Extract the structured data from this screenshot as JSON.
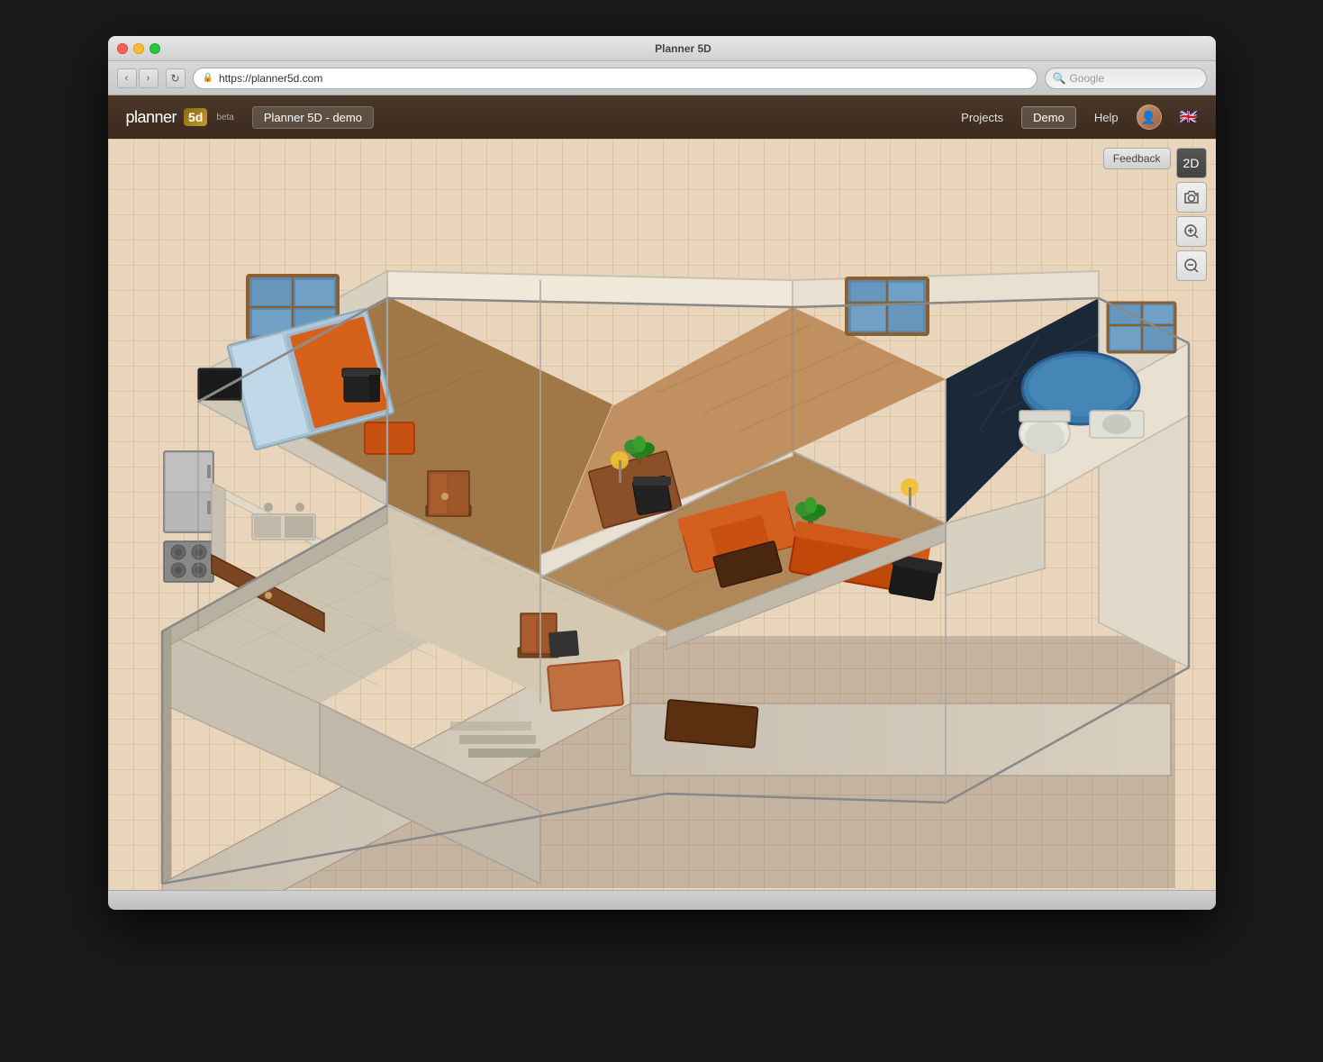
{
  "window": {
    "title": "Planner 5D"
  },
  "browser": {
    "url": "https://planner5d.com",
    "search_placeholder": "Google",
    "back_label": "‹",
    "forward_label": "›",
    "reload_label": "↻"
  },
  "header": {
    "logo_text": "planner",
    "logo_box": "5d",
    "beta_label": "beta",
    "project_name": "Planner 5D - demo",
    "nav": {
      "projects_label": "Projects",
      "demo_label": "Demo",
      "help_label": "Help"
    }
  },
  "toolbar": {
    "feedback_label": "Feedback",
    "btn_2d_label": "2D",
    "btn_camera_label": "📷",
    "btn_zoom_in_label": "⊕",
    "btn_zoom_out_label": "⊖"
  },
  "canvas": {
    "background_color": "#e8d5bc",
    "grid_color": "#d4b896"
  }
}
